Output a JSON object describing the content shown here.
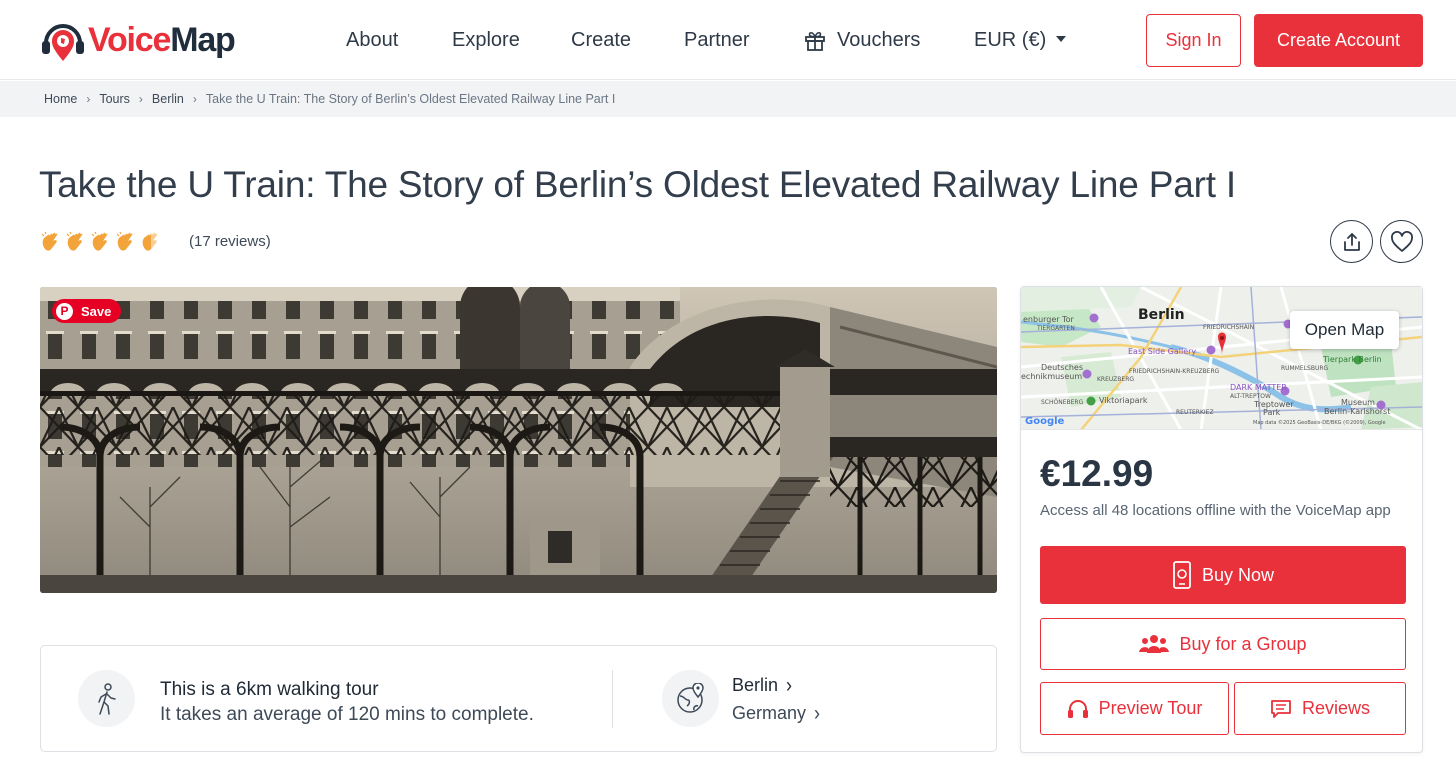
{
  "brand": {
    "logo_voice": "Voice",
    "logo_map": "Map",
    "accent_color": "#e8313b"
  },
  "nav": {
    "about": "About",
    "explore": "Explore",
    "create": "Create",
    "partner": "Partner",
    "vouchers": "Vouchers",
    "currency": "EUR (€)",
    "sign_in": "Sign In",
    "create_account": "Create Account"
  },
  "breadcrumb": {
    "home": "Home",
    "tours": "Tours",
    "city": "Berlin",
    "current": "Take the U Train: The Story of Berlin’s Oldest Elevated Railway Line Part I"
  },
  "tour": {
    "title": "Take the U Train: The Story of Berlin’s Oldest Elevated Railway Line Part I",
    "rating": 4.5,
    "rating_max": 5,
    "reviews_count": "(17 reviews)",
    "save_label": "Save",
    "walk_title": "This is a 6km walking tour",
    "walk_sub": "It takes an average of 120 mins to complete.",
    "city": "Berlin",
    "country": "Germany"
  },
  "map": {
    "open_map": "Open Map",
    "labels": {
      "berlin": "Berlin",
      "tiergarten": "TIERGARTEN",
      "brandenburger": "enburger Tor",
      "friedrichshain": "FRIEDRICHSHAIN",
      "east_side": "East Side Gallery",
      "deutsches": "Deutsches",
      "technik": "echnikmuseum",
      "fk": "FRIEDRICHSHAIN-KREUZBERG",
      "kreuzberg": "KREUZBERG",
      "rummelsburg": "RUMMELSBURG",
      "tierpark": "Tierpark Berlin",
      "dark_matter": "DARK MATTER",
      "alt_treptow": "ALT-TREPTOW",
      "schoneberg": "SCHÖNEBERG",
      "viktoriapark": "Viktoriapark",
      "reuterkiez": "REUTERKIEZ",
      "treptower": "Treptower",
      "park": "Park",
      "museum": "Museum",
      "karlshorst": "Berlin-Karlshorst",
      "google": "Google",
      "attribution": "Map data ©2025 GeoBasis-DE/BKG (©2009), Google"
    }
  },
  "purchase": {
    "price": "€12.99",
    "access_text": "Access all 48 locations offline with the VoiceMap app",
    "buy_now": "Buy Now",
    "buy_group": "Buy for a Group",
    "preview": "Preview Tour",
    "reviews": "Reviews"
  }
}
